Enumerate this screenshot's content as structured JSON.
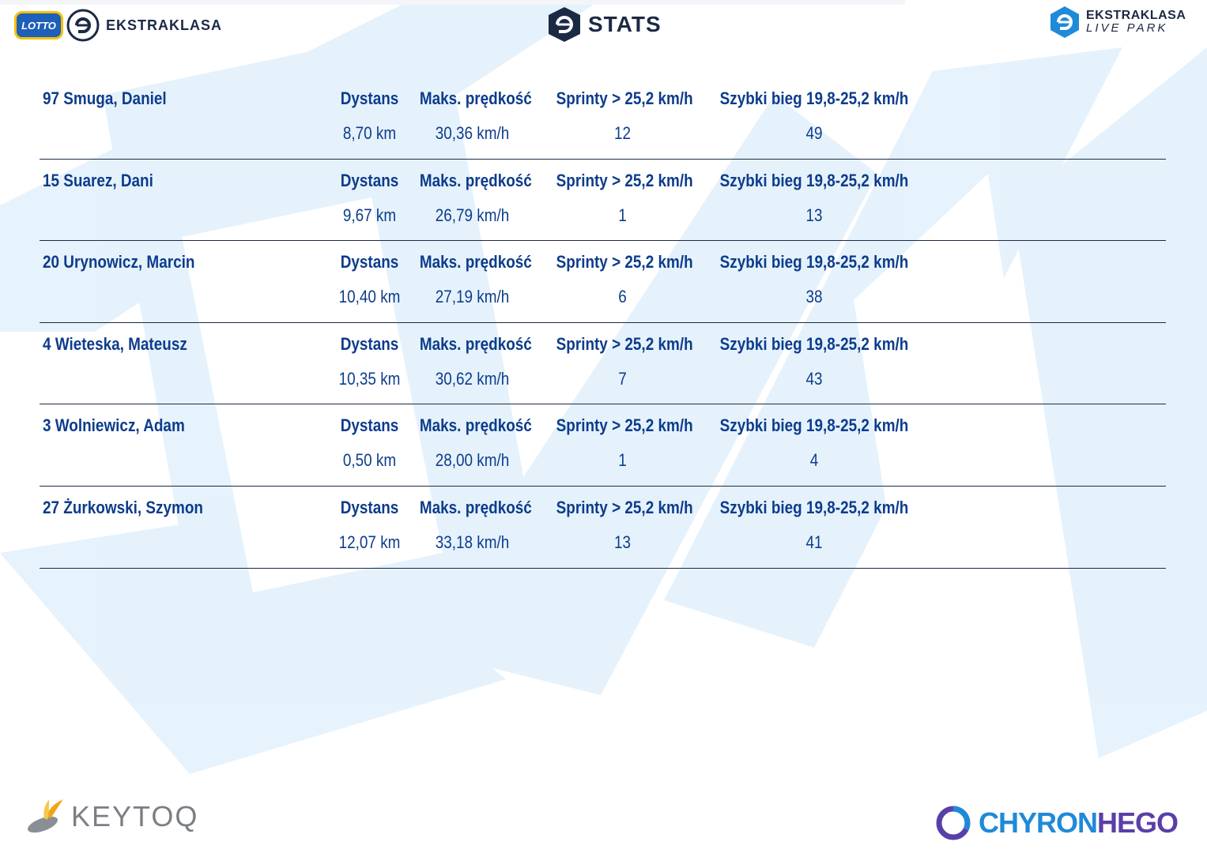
{
  "header": {
    "left_badge": "LOTTO",
    "left_brand": "EKSTRAKLASA",
    "center_brand": "STATS",
    "right_brand_line1": "EKSTRAKLASA",
    "right_brand_line2": "LIVE PARK"
  },
  "columns": {
    "distance": "Dystans",
    "max_speed": "Maks. prędkość",
    "sprints": "Sprinty > 25,2 km/h",
    "fast_run": "Szybki bieg 19,8-25,2 km/h"
  },
  "players": [
    {
      "name": "97  Smuga, Daniel",
      "distance": "8,70 km",
      "max_speed": "30,36 km/h",
      "sprints": "12",
      "fast_run": "49"
    },
    {
      "name": "15  Suarez, Dani",
      "distance": "9,67 km",
      "max_speed": "26,79 km/h",
      "sprints": "1",
      "fast_run": "13"
    },
    {
      "name": "20  Urynowicz, Marcin",
      "distance": "10,40 km",
      "max_speed": "27,19 km/h",
      "sprints": "6",
      "fast_run": "38"
    },
    {
      "name": "4  Wieteska, Mateusz",
      "distance": "10,35 km",
      "max_speed": "30,62 km/h",
      "sprints": "7",
      "fast_run": "43"
    },
    {
      "name": "3  Wolniewicz, Adam",
      "distance": "0,50 km",
      "max_speed": "28,00 km/h",
      "sprints": "1",
      "fast_run": "4"
    },
    {
      "name": "27  Żurkowski, Szymon",
      "distance": "12,07 km",
      "max_speed": "33,18 km/h",
      "sprints": "13",
      "fast_run": "41"
    }
  ],
  "footer": {
    "left_logo": "KEYTOQ",
    "right_logo_part1": "CHYRON",
    "right_logo_part2": "HEGO"
  },
  "colors": {
    "text_primary": "#0d3c8c",
    "divider": "#1b2a44",
    "background_shape": "#dceefb"
  }
}
